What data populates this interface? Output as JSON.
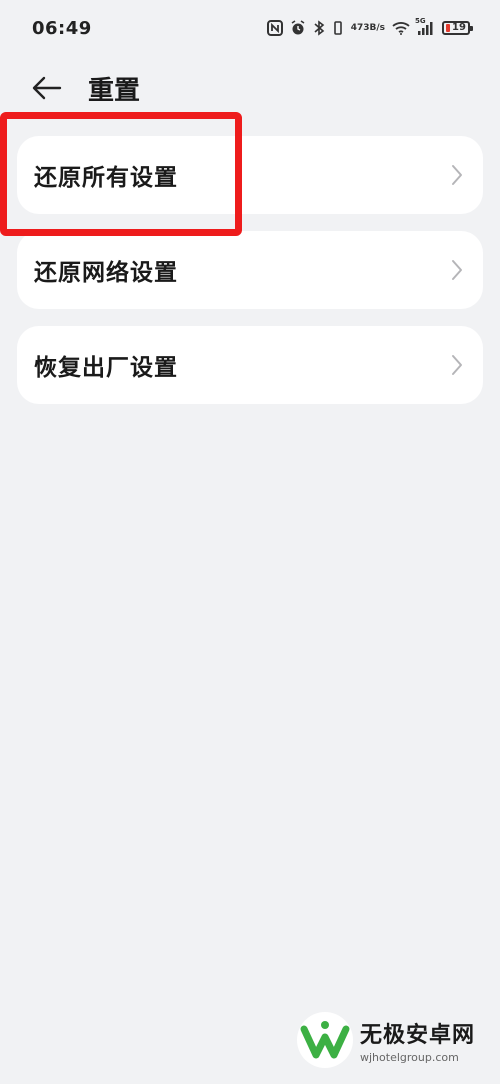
{
  "status_bar": {
    "time": "06:49",
    "net_speed_value": "473",
    "net_speed_unit": "B/s",
    "signal_label": "5G",
    "battery_level": "19"
  },
  "header": {
    "title": "重置"
  },
  "list": {
    "items": [
      {
        "label": "还原所有设置"
      },
      {
        "label": "还原网络设置"
      },
      {
        "label": "恢复出厂设置"
      }
    ]
  },
  "watermark": {
    "title": "无极安卓网",
    "url": "wjhotelgroup.com"
  },
  "colors": {
    "background": "#f1f2f4",
    "card": "#ffffff",
    "highlight": "#ee1c1c",
    "logo_green": "#3cb043"
  }
}
